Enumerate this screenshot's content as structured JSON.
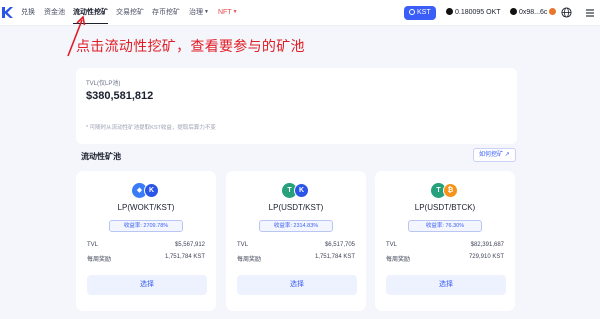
{
  "nav": {
    "items": [
      "兑换",
      "资金池",
      "流动性挖矿",
      "交易挖矿",
      "存币挖矿",
      "治理",
      "NFT"
    ],
    "kst_badge": "KST",
    "balance": "0.180095 OKT",
    "account": "0x98...6c"
  },
  "annotation": "点击流动性挖矿，查看要参与的矿池",
  "tvl": {
    "label": "TVL(仅LP池)",
    "value": "$380,581,812",
    "note": "* 可随时从流动性矿池提取KST收益，提取后算力不变"
  },
  "pools_section": {
    "title": "流动性矿池",
    "how_to": "如何挖矿"
  },
  "pools": [
    {
      "name": "LP(WOKT/KST)",
      "apr": "收益率: 2709.78%",
      "tvl_label": "TVL",
      "tvl": "$5,567,912",
      "reward_label": "每周奖励",
      "reward": "1,751,784 KST",
      "action": "选择",
      "coin1": "◆",
      "coin2": "K",
      "color1": "#3a7bf7",
      "color2": "#2b55e6"
    },
    {
      "name": "LP(USDT/KST)",
      "apr": "收益率: 2314.83%",
      "tvl_label": "TVL",
      "tvl": "$6,517,705",
      "reward_label": "每周奖励",
      "reward": "1,751,784 KST",
      "action": "选择",
      "coin1": "T",
      "coin2": "K",
      "color1": "#26a17b",
      "color2": "#2b55e6"
    },
    {
      "name": "LP(USDT/BTCK)",
      "apr": "收益率: 76.30%",
      "tvl_label": "TVL",
      "tvl": "$82,391,687",
      "reward_label": "每周奖励",
      "reward": "729,910 KST",
      "action": "选择",
      "coin1": "T",
      "coin2": "₿",
      "color1": "#26a17b",
      "color2": "#f7931a"
    }
  ],
  "colors": {
    "accent": "#3a5ef7",
    "annotation": "#e11d25",
    "nft": "#e5484d"
  }
}
